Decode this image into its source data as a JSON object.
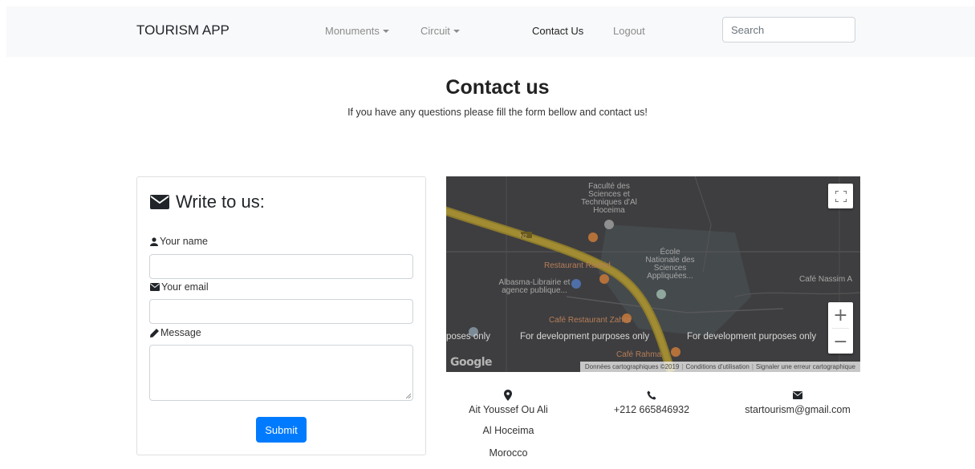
{
  "navbar": {
    "brand": "TOURISM APP",
    "items": [
      {
        "label": "Monuments",
        "dropdown": true
      },
      {
        "label": "Circuit",
        "dropdown": true
      },
      {
        "label": "Contact Us",
        "active": true
      },
      {
        "label": "Logout"
      }
    ],
    "search_placeholder": "Search"
  },
  "header": {
    "title": "Contact us",
    "subtitle": "If you have any questions please fill the form bellow and contact us!"
  },
  "form": {
    "title": "Write to us:",
    "name_label": "Your name",
    "email_label": "Your email",
    "message_label": "Message",
    "submit_label": "Submit"
  },
  "map": {
    "labels": {
      "faculte": "Faculté des Sciences et Techniques d'Al Hoceima",
      "ecole": "École Nationale des Sciences Appliquées...",
      "restaurant_rachid": "Restaurant Rachid",
      "albasma": "Albasma-Librairie et agence publique...",
      "cafe_nassim": "Café Nassim A",
      "cafe_zahra": "Café Restaurant Zahra",
      "cafe_rahma": "Café Rahma",
      "road": "N2"
    },
    "dev_text_left": "poses only",
    "dev_text_center": "For development purposes only",
    "dev_text_right": "For development purposes only",
    "google_brand": "Google",
    "attribution": {
      "data": "Données cartographiques ©2019",
      "terms": "Conditions d'utilisation",
      "report": "Signaler une erreur cartographique"
    }
  },
  "contact": {
    "address_lines": [
      "Ait Youssef Ou Ali",
      "Al Hoceima",
      "Morocco"
    ],
    "phone": "+212 665846932",
    "email": "startourism@gmail.com"
  },
  "icons": {
    "address": "map-marker-icon",
    "phone": "phone-icon",
    "email": "envelope-icon"
  }
}
